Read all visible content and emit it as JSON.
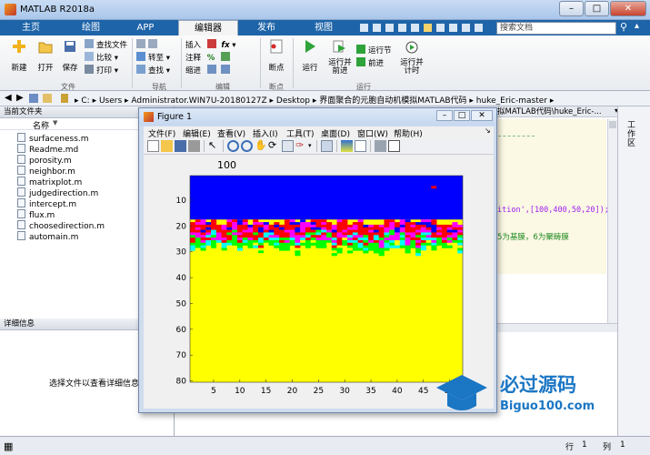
{
  "window": {
    "title": "MATLAB R2018a",
    "controls": [
      "–",
      "□",
      "✕"
    ]
  },
  "ribbon_tabs": [
    "主页",
    "绘图",
    "APP",
    "编辑器",
    "发布",
    "视图"
  ],
  "active_tab": "编辑器",
  "search": {
    "placeholder": "搜索文档"
  },
  "ribbon": {
    "file": {
      "new": "新建",
      "open": "打开",
      "save": "保存",
      "find_files": "查找文件",
      "compare": "比较",
      "print": "打印",
      "label": "文件"
    },
    "nav": {
      "goto": "转至",
      "find": "查找",
      "label": "导航"
    },
    "edit": {
      "insert": "插入",
      "comment": "注释",
      "indent": "缩进",
      "fx": "fx",
      "label": "编辑"
    },
    "breakpoints": {
      "btn": "断点",
      "label": "断点"
    },
    "run": {
      "run": "运行",
      "run_advance": "运行并前进",
      "run_section": "运行节",
      "advance": "前进",
      "run_time": "运行并计时",
      "label": "运行"
    }
  },
  "address": {
    "path": [
      "C:",
      "Users",
      "Administrator.WIN7U-20180127Z",
      "Desktop",
      "界面聚合的元胞自动机模拟MATLAB代码",
      "huke_Eric-master"
    ]
  },
  "left_panel": {
    "title": "当前文件夹",
    "column": "名称",
    "files": [
      "surfaceness.m",
      "Readme.md",
      "porosity.m",
      "neighbor.m",
      "matrixplot.m",
      "judgedirection.m",
      "intercept.m",
      "flux.m",
      "choosedirection.m",
      "automain.m"
    ],
    "details_title": "详细信息",
    "details_text": "选择文件以查看详细信息"
  },
  "editor": {
    "tab_text": "拟MATLAB代码\\huke_Eric-...",
    "code_line1": "ition',[100,400,50,20]);",
    "code_line2": "5为基膜，6为聚畴膜"
  },
  "right_side": {
    "workspace": "工作区"
  },
  "status": {
    "row_label": "行",
    "row": "1",
    "col_label": "列",
    "col": "1"
  },
  "figure": {
    "title": "Figure 1",
    "menu": [
      "文件(F)",
      "编辑(E)",
      "查看(V)",
      "插入(I)",
      "工具(T)",
      "桌面(D)",
      "窗口(W)",
      "帮助(H)"
    ],
    "plot_title": "100",
    "yticks": [
      "10",
      "20",
      "30",
      "40",
      "50",
      "60",
      "70",
      "80"
    ],
    "xticks": [
      "5",
      "10",
      "15",
      "20",
      "25",
      "30",
      "35",
      "40",
      "45",
      "50"
    ],
    "colors": {
      "top": "#0000ff",
      "mid_red": "#ff0000",
      "mid_mag": "#ff00ff",
      "mid_grn": "#00ff00",
      "mid_cyan": "#00ffff",
      "bottom": "#ffff00"
    }
  },
  "watermark": {
    "text": "必过源码",
    "url": "Biguo100.com"
  }
}
